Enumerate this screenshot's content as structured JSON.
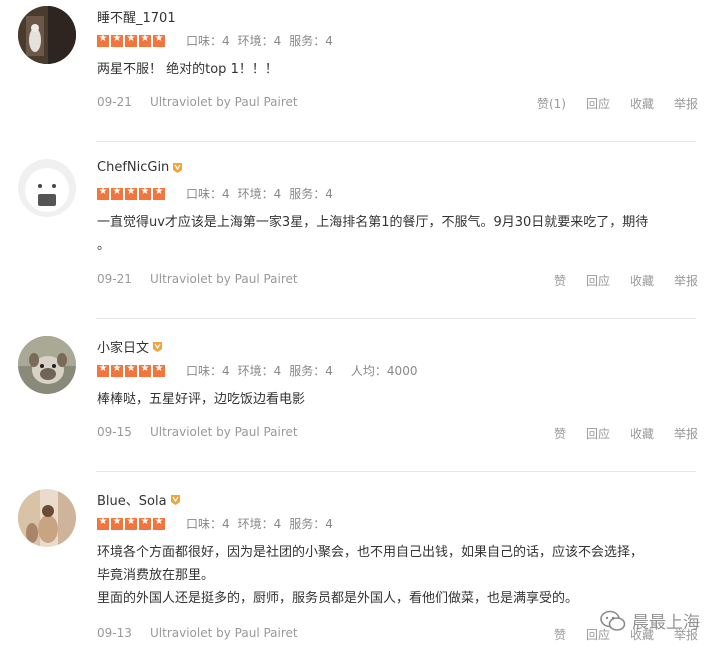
{
  "reviews": [
    {
      "username": "睡不醒_1701",
      "vip": false,
      "stars": 5,
      "scores": [
        "口味：4",
        "环境：4",
        "服务：4"
      ],
      "avg": "",
      "text": [
        "两星不服！ 绝对的top 1！！！"
      ],
      "date": "09-21",
      "source": "Ultraviolet by Paul Pairet",
      "actions": [
        "赞(1)",
        "回应",
        "收藏",
        "举报"
      ]
    },
    {
      "username": "ChefNicGin",
      "vip": true,
      "stars": 5,
      "scores": [
        "口味：4",
        "环境：4",
        "服务：4"
      ],
      "avg": "",
      "text": [
        "一直觉得uv才应该是上海第一家3星，上海排名第1的餐厅，不服气。9月30日就要来吃了，期待",
        "。"
      ],
      "date": "09-21",
      "source": "Ultraviolet by Paul Pairet",
      "actions": [
        "赞",
        "回应",
        "收藏",
        "举报"
      ]
    },
    {
      "username": "小家日文",
      "vip": true,
      "stars": 5,
      "scores": [
        "口味：4",
        "环境：4",
        "服务：4"
      ],
      "avg": "人均：4000",
      "text": [
        "棒棒哒，五星好评，边吃饭边看电影"
      ],
      "date": "09-15",
      "source": "Ultraviolet by Paul Pairet",
      "actions": [
        "赞",
        "回应",
        "收藏",
        "举报"
      ]
    },
    {
      "username": "Blue、Sola",
      "vip": true,
      "stars": 5,
      "scores": [
        "口味：4",
        "环境：4",
        "服务：4"
      ],
      "avg": "",
      "text": [
        "环境各个方面都很好，因为是社团的小聚会，也不用自己出钱，如果自己的话，应该不会选择，",
        "毕竟消费放在那里。",
        "里面的外国人还是挺多的，厨师，服务员都是外国人，看他们做菜，也是满享受的。"
      ],
      "date": "09-13",
      "source": "Ultraviolet by Paul Pairet",
      "actions": [
        "赞",
        "回应",
        "收藏",
        "举报"
      ]
    }
  ],
  "watermark": "晨最上海",
  "colors": {
    "star": "#f1753d",
    "divider": "#e6e6e6",
    "meta": "#999999",
    "text": "#333333"
  }
}
